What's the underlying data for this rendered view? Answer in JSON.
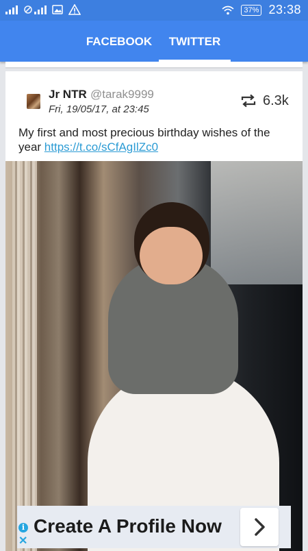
{
  "status_bar": {
    "battery": "37%",
    "time": "23:38",
    "icons": [
      "signal-icon",
      "no-signal-icon",
      "image-icon",
      "warning-icon",
      "wifi-icon",
      "battery-icon"
    ]
  },
  "tabs": [
    {
      "label": "FACEBOOK",
      "selected": false
    },
    {
      "label": "TWITTER",
      "selected": true
    }
  ],
  "tweet": {
    "author_name": "Jr NTR",
    "author_handle": "@tarak9999",
    "date": "Fri, 19/05/17, at 23:45",
    "retweet_count": "6.3k",
    "text": "My first and most precious birthday wishes of the year ",
    "link": "https://t.co/sCfAgIlZc0"
  },
  "ad": {
    "text": "Create A Profile Now",
    "info_icon_label": "i",
    "close_label": "✕"
  },
  "colors": {
    "status_bar": "#3d7fe0",
    "tab_bar": "#4185ee",
    "link": "#2b9bd4",
    "ad_accent": "#27a6e0"
  }
}
